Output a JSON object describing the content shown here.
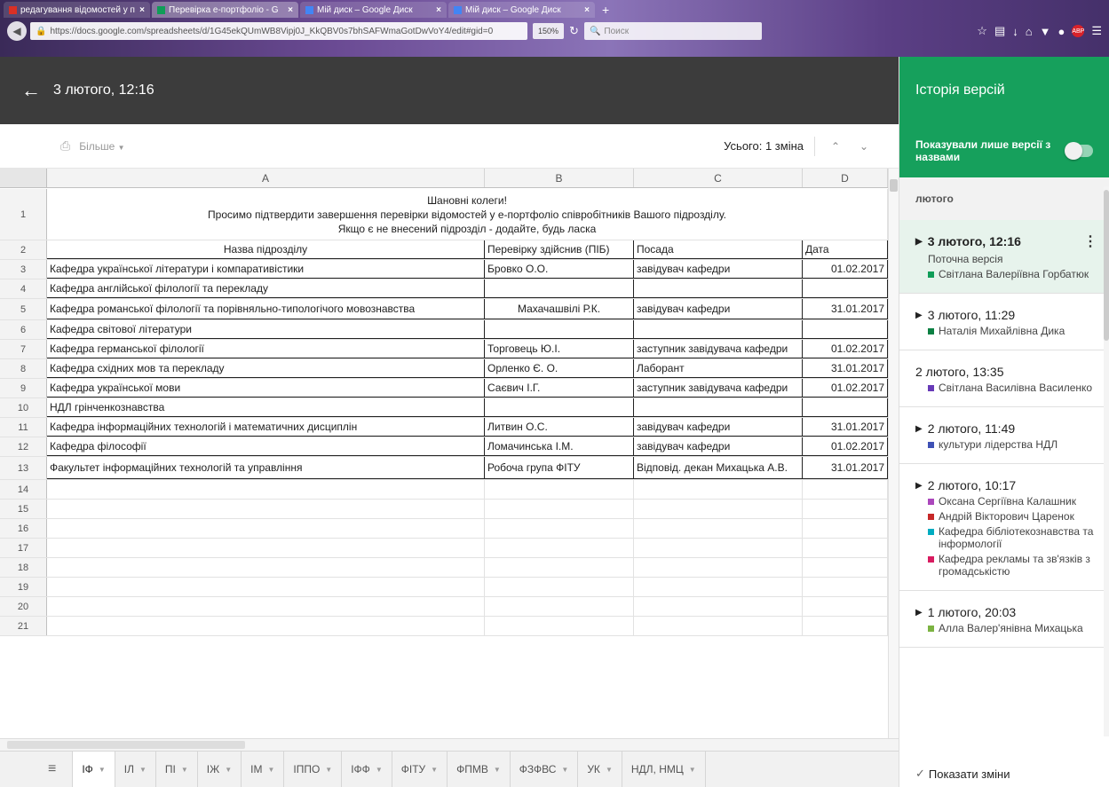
{
  "browser": {
    "tabs": [
      {
        "title": "редагування відомостей у п",
        "color": "#d93025",
        "active": false
      },
      {
        "title": "Перевірка е-портфоліо - G",
        "color": "#0f9d58",
        "active": true
      },
      {
        "title": "Мій диск – Google Диск",
        "color": "#4285f4",
        "active": false
      },
      {
        "title": "Мій диск – Google Диск",
        "color": "#4285f4",
        "active": false
      }
    ],
    "new_tab": "+",
    "url": "https://docs.google.com/spreadsheets/d/1G45ekQUmWB8Vipj0J_KkQBV0s7bhSAFWmaGotDwVoY4/edit#gid=0",
    "zoom": "150%",
    "search_placeholder": "Поиск"
  },
  "revision": {
    "title": "3 лютого, 12:16"
  },
  "toolbar": {
    "more_label": "Більше",
    "total_changes": "Усього: 1 зміна"
  },
  "grid": {
    "columns": [
      "A",
      "B",
      "C",
      "D"
    ],
    "header_lines": [
      "Шановні колеги!",
      "Просимо підтвердити завершення перевірки відомостей у е-портфоліо співробітників Вашого підрозділу.",
      "Якщо є не внесений підрозділ - додайте, будь ласка"
    ],
    "table_header": [
      "Назва підрозділу",
      "Перевірку здійснив (ПІБ)",
      "Посада",
      "Дата"
    ],
    "rows": [
      [
        "Кафедра української літератури і компаративістики",
        "Бровко О.О.",
        "завідувач кафедри",
        "01.02.2017"
      ],
      [
        "Кафедра англійської філології та перекладу",
        "",
        "",
        ""
      ],
      [
        "Кафедра романської філології та порівняльно-типологічого мовознавства",
        "Махачашвілі Р.К.",
        "завідувач кафедри",
        "31.01.2017"
      ],
      [
        "Кафедра світової літератури",
        "",
        "",
        ""
      ],
      [
        "Кафедра германської філології",
        "Торговець Ю.І.",
        "заступник завідувача кафедри",
        "01.02.2017"
      ],
      [
        "Кафедра східних мов та перекладу",
        "Орленко Є. О.",
        "Лаборант",
        "31.01.2017"
      ],
      [
        "Кафедра української мови",
        "Саєвич І.Г.",
        "заступник завідувача кафедри",
        "01.02.2017"
      ],
      [
        "НДЛ грінченкознавства",
        "",
        "",
        ""
      ],
      [
        "Кафедра інформаційних технологій і математичних дисциплін",
        "Литвин О.С.",
        "завідувач кафедри",
        "31.01.2017"
      ],
      [
        "Кафедра філософії",
        "Ломачинська І.М.",
        "завідувач кафедри",
        "01.02.2017"
      ],
      [
        "Факультет інформаційних технологій та управління",
        "Робоча група ФІТУ",
        "Відповід. декан Михацька А.В.",
        "31.01.2017"
      ]
    ],
    "row_numbers": [
      "1",
      "2",
      "3",
      "4",
      "5",
      "6",
      "7",
      "8",
      "9",
      "10",
      "11",
      "12",
      "13",
      "14",
      "15",
      "16",
      "17",
      "18",
      "19",
      "20",
      "21"
    ]
  },
  "sheet_tabs": [
    "ІФ",
    "ІЛ",
    "ПІ",
    "ІЖ",
    "ІМ",
    "ІППО",
    "ІФФ",
    "ФІТУ",
    "ФПМВ",
    "ФЗФВС",
    "УК",
    "НДЛ, НМЦ"
  ],
  "history": {
    "title": "Історія версій",
    "named_only_label": "Показували лише версії з назвами",
    "month": "лютого",
    "show_changes_label": "Показати зміни",
    "versions": [
      {
        "title": "3 лютого, 12:16",
        "subtitle": "Поточна версія",
        "expandable": true,
        "authors": [
          {
            "name": "Світлана Валеріївна Горбатюк",
            "color": "#0f9d58"
          }
        ]
      },
      {
        "title": "3 лютого, 11:29",
        "subtitle": "",
        "expandable": true,
        "authors": [
          {
            "name": "Наталія Михайлівна Дика",
            "color": "#0b8043"
          }
        ]
      },
      {
        "title": "2 лютого, 13:35",
        "subtitle": "",
        "expandable": false,
        "authors": [
          {
            "name": "Світлана Василівна Василенко",
            "color": "#673ab7"
          }
        ]
      },
      {
        "title": "2 лютого, 11:49",
        "subtitle": "",
        "expandable": true,
        "authors": [
          {
            "name": "культури лідерства НДЛ",
            "color": "#3f51b5"
          }
        ]
      },
      {
        "title": "2 лютого, 10:17",
        "subtitle": "",
        "expandable": true,
        "authors": [
          {
            "name": "Оксана Сергіївна Калашник",
            "color": "#ab47bc"
          },
          {
            "name": "Андрій Вікторович Царенок",
            "color": "#c62828"
          },
          {
            "name": "Кафедра бібліотекознавства та інформології",
            "color": "#00acc1"
          },
          {
            "name": "Кафедра рекламы та зв'язків з громадськістю",
            "color": "#d81b60"
          }
        ]
      },
      {
        "title": "1 лютого, 20:03",
        "subtitle": "",
        "expandable": true,
        "authors": [
          {
            "name": "Алла Валер'янівна Михацька",
            "color": "#7cb342"
          }
        ]
      }
    ]
  }
}
